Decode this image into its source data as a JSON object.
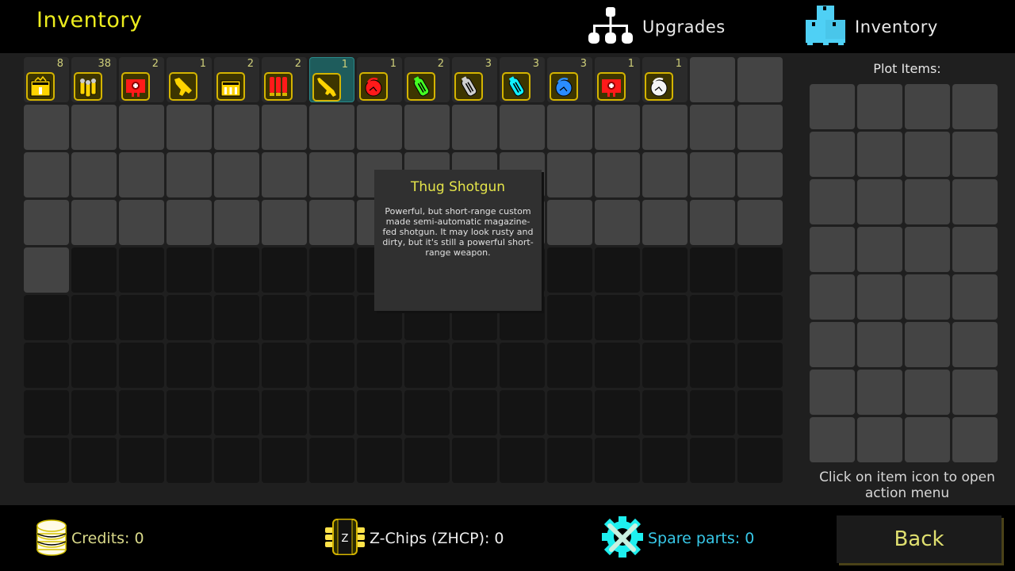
{
  "header": {
    "title": "Inventory",
    "tabs": [
      {
        "label": "Upgrades",
        "icon": "hierarchy-icon",
        "active": false
      },
      {
        "label": "Inventory",
        "icon": "boxes-pallet-icon",
        "active": true
      }
    ]
  },
  "inventory": {
    "columns": 16,
    "rows": 9,
    "unlocked_slots": 65,
    "items": [
      {
        "name": "Power Cell Battery",
        "icon": "battery-pack-icon",
        "count": "8",
        "color": "#ffd400"
      },
      {
        "name": "Rifle Ammo",
        "icon": "bullets-icon",
        "count": "38",
        "color": "#ffd400"
      },
      {
        "name": "Large Medkit",
        "icon": "medkit-icon",
        "count": "2",
        "color": "#ff1a1a"
      },
      {
        "name": "SMG",
        "icon": "smg-icon",
        "count": "1",
        "color": "#ffd400"
      },
      {
        "name": "Energy Cells",
        "icon": "energy-cells-icon",
        "count": "2",
        "color": "#ffd400"
      },
      {
        "name": "Shotgun Shells",
        "icon": "shells-icon",
        "count": "2",
        "color": "#ff1a1a"
      },
      {
        "name": "Thug Shotgun",
        "icon": "shotgun-icon",
        "count": "1",
        "color": "#ffd400",
        "selected": true
      },
      {
        "name": "Red Grenade",
        "icon": "grenade-icon",
        "count": "1",
        "color": "#ff1a1a"
      },
      {
        "name": "Green Stim",
        "icon": "canister-icon",
        "count": "2",
        "color": "#44ff22"
      },
      {
        "name": "Grey Stim",
        "icon": "canister-icon",
        "count": "3",
        "color": "#cfcfcf"
      },
      {
        "name": "Cyan Stim",
        "icon": "canister-icon",
        "count": "3",
        "color": "#10f0ff"
      },
      {
        "name": "Blue Grenade",
        "icon": "grenade-icon",
        "count": "3",
        "color": "#2a8cff"
      },
      {
        "name": "Small Medkit",
        "icon": "medkit-icon",
        "count": "1",
        "color": "#ff1a1a"
      },
      {
        "name": "White Grenade",
        "icon": "grenade-icon",
        "count": "1",
        "color": "#f4f4f4"
      }
    ]
  },
  "tooltip": {
    "title": "Thug Shotgun",
    "description": "Powerful, but short-range custom made semi-automatic magazine-fed shotgun. It may look rusty and dirty, but it's still a powerful short-range weapon."
  },
  "plot_panel": {
    "title": "Plot Items:",
    "columns": 4,
    "rows": 8,
    "hint": "Click on item icon to open action menu"
  },
  "footer": {
    "credits": "Credits: 0",
    "zchips": "Z-Chips (ZHCP): 0",
    "spare_parts": "Spare parts: 0",
    "back_label": "Back"
  },
  "colors": {
    "title_yellow": "#ecec1e",
    "accent_cyan": "#37c8e8",
    "item_frame": "#d4b400",
    "selected_cell": "#1e5c5c"
  }
}
